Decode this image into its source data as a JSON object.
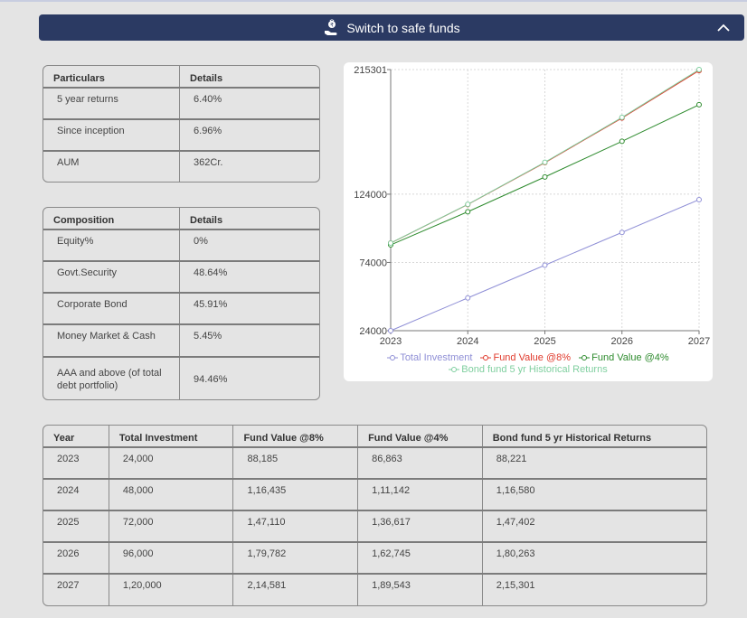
{
  "banner": {
    "label": "Switch to safe funds"
  },
  "returns_table": {
    "headers": [
      "Particulars",
      "Details"
    ],
    "rows": [
      [
        "5 year returns",
        "6.40%"
      ],
      [
        "Since inception",
        "6.96%"
      ],
      [
        "AUM",
        "362Cr."
      ]
    ]
  },
  "composition_table": {
    "headers": [
      "Composition",
      "Details"
    ],
    "rows": [
      [
        "Equity%",
        "0%"
      ],
      [
        "Govt.Security",
        "48.64%"
      ],
      [
        "Corporate Bond",
        "45.91%"
      ],
      [
        "Money Market & Cash",
        "5.45%"
      ],
      [
        "AAA and above (of total debt portfolio)",
        "94.46%"
      ]
    ]
  },
  "projection_table": {
    "headers": [
      "Year",
      "Total Investment",
      "Fund Value @8%",
      "Fund Value @4%",
      "Bond fund 5 yr Historical Returns"
    ],
    "rows": [
      [
        "2023",
        "24,000",
        "88,185",
        "86,863",
        "88,221"
      ],
      [
        "2024",
        "48,000",
        "1,16,435",
        "1,11,142",
        "1,16,580"
      ],
      [
        "2025",
        "72,000",
        "1,47,110",
        "1,36,617",
        "1,47,402"
      ],
      [
        "2026",
        "96,000",
        "1,79,782",
        "1,62,745",
        "1,80,263"
      ],
      [
        "2027",
        "1,20,000",
        "2,14,581",
        "1,89,543",
        "2,15,301"
      ]
    ]
  },
  "chart_data": {
    "type": "line",
    "x": [
      2023,
      2024,
      2025,
      2026,
      2027
    ],
    "y_ticks": [
      "24000",
      "74000",
      "124000",
      "215301"
    ],
    "y_tick_values": [
      24000,
      74000,
      124000,
      215301
    ],
    "ylim": [
      24000,
      215301
    ],
    "grid": true,
    "legend_placement": "bottom",
    "series": [
      {
        "name": "Total Investment",
        "color": "#8f8fd6",
        "values": [
          24000,
          48000,
          72000,
          96000,
          120000
        ]
      },
      {
        "name": "Fund Value @8%",
        "color": "#e03a2c",
        "values": [
          88185,
          116435,
          147110,
          179782,
          214581
        ]
      },
      {
        "name": "Fund Value @4%",
        "color": "#2e8b2e",
        "values": [
          86863,
          111142,
          136617,
          162745,
          189543
        ]
      },
      {
        "name": "Bond fund 5 yr Historical Returns",
        "color": "#7fcf9f",
        "values": [
          88221,
          116580,
          147402,
          180263,
          215301
        ]
      }
    ]
  }
}
